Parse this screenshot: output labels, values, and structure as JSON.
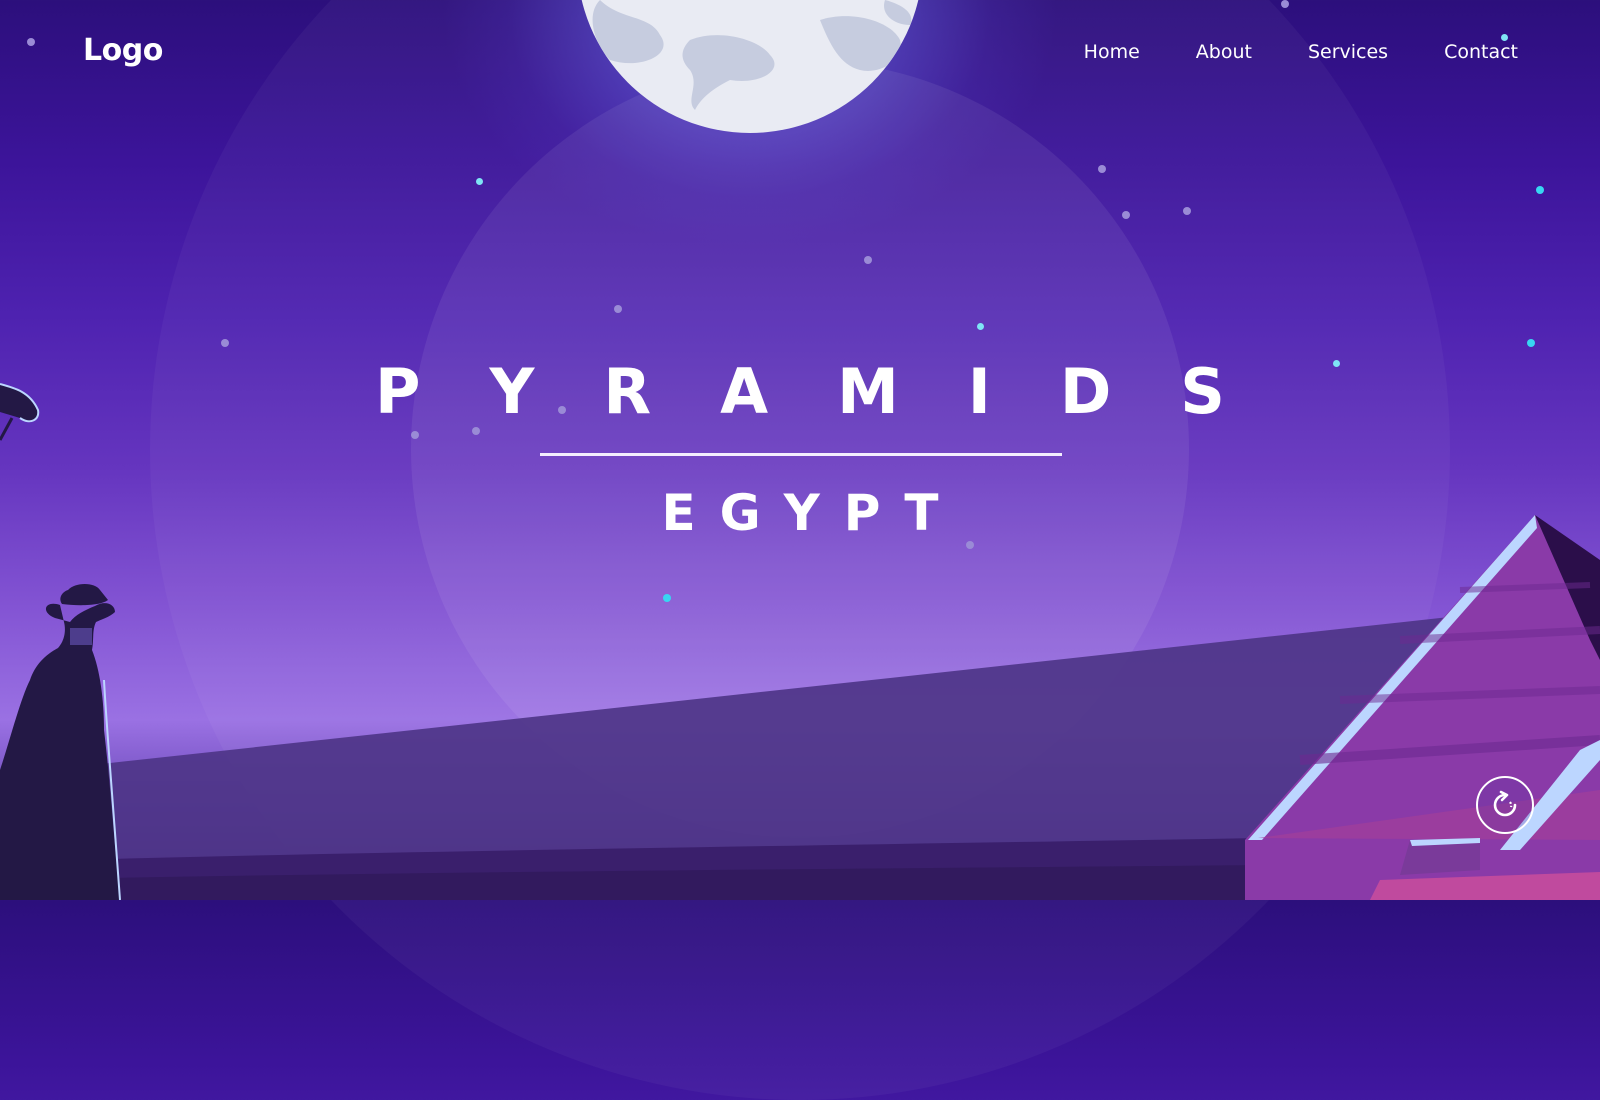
{
  "nav": {
    "logo": "Logo",
    "links": [
      {
        "label": "Home"
      },
      {
        "label": "About"
      },
      {
        "label": "Services"
      },
      {
        "label": "Contact"
      }
    ]
  },
  "hero": {
    "title": "PYRAMIDS",
    "subtitle": "EGYPT"
  },
  "icons": {
    "scroll_button": "refresh-icon"
  },
  "colors": {
    "sky_top": "#2c0f7c",
    "sky_bottom": "#9a71e3",
    "ground": "#4e3588",
    "pyramid": "#8a3aa8",
    "text": "#ffffff"
  }
}
